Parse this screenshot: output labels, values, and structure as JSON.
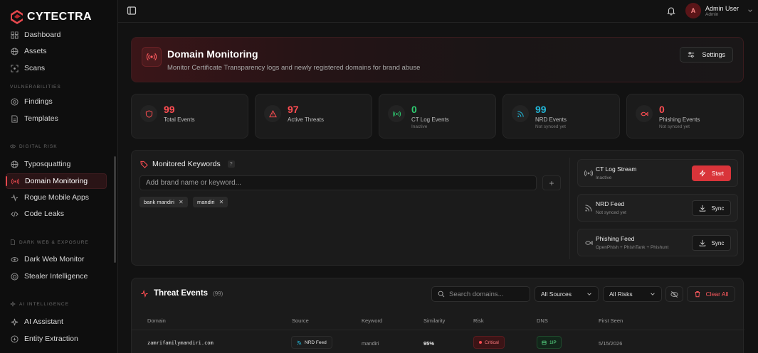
{
  "app": {
    "brand": "CYTECTRA"
  },
  "sidebar": {
    "items_top": [
      {
        "label": "Dashboard",
        "icon": "dashboard-icon"
      },
      {
        "label": "Assets",
        "icon": "globe-icon"
      },
      {
        "label": "Scans",
        "icon": "scan-icon"
      }
    ],
    "sections": {
      "vulnerabilities": "VULNERABILITIES",
      "digital_risk": "DIGITAL RISK",
      "dark_web": "DARK WEB & EXPOSURE",
      "ai": "AI INTELLIGENCE"
    },
    "vuln_items": [
      {
        "label": "Findings",
        "icon": "findings-icon"
      },
      {
        "label": "Templates",
        "icon": "templates-icon"
      }
    ],
    "risk_items": [
      {
        "label": "Typosquatting",
        "icon": "globe-icon"
      },
      {
        "label": "Domain Monitoring",
        "icon": "radio-icon",
        "active": true
      },
      {
        "label": "Rogue Mobile Apps",
        "icon": "activity-icon"
      },
      {
        "label": "Code Leaks",
        "icon": "code-icon"
      }
    ],
    "darkweb_items": [
      {
        "label": "Dark Web Monitor",
        "icon": "eye-icon"
      },
      {
        "label": "Stealer Intelligence",
        "icon": "target-icon"
      }
    ],
    "ai_items": [
      {
        "label": "AI Assistant",
        "icon": "sparkle-icon"
      },
      {
        "label": "Entity Extraction",
        "icon": "extract-icon"
      }
    ]
  },
  "topbar": {
    "user_initial": "A",
    "user_name": "Admin User",
    "user_role": "Admin"
  },
  "header": {
    "title": "Domain Monitoring",
    "subtitle": "Monitor Certificate Transparency logs and newly registered domains for brand abuse",
    "settings_label": "Settings"
  },
  "stats": [
    {
      "value": "99",
      "label": "Total Events",
      "sub": "",
      "color": "#ff4d52"
    },
    {
      "value": "97",
      "label": "Active Threats",
      "sub": "",
      "color": "#ff4d52"
    },
    {
      "value": "0",
      "label": "CT Log Events",
      "sub": "Inactive",
      "color": "#2ecc71"
    },
    {
      "value": "99",
      "label": "NRD Events",
      "sub": "Not synced yet",
      "color": "#22b5d6"
    },
    {
      "value": "0",
      "label": "Phishing Events",
      "sub": "Not synced yet",
      "color": "#ff4d52"
    }
  ],
  "keywords": {
    "title": "Monitored Keywords",
    "help": "?",
    "placeholder": "Add brand name or keyword...",
    "chips": [
      "bank mandiri",
      "mandiri"
    ]
  },
  "feeds": [
    {
      "title": "CT Log Stream",
      "sub": "Inactive",
      "button": "Start"
    },
    {
      "title": "NRD Feed",
      "sub": "Not synced yet",
      "button": "Sync"
    },
    {
      "title": "Phishing Feed",
      "sub": "OpenPhish + PhishTank + Phishunt",
      "button": "Sync"
    }
  ],
  "threats": {
    "title": "Threat Events",
    "count": "(99)",
    "search_placeholder": "Search domains...",
    "source_filter": "All Sources",
    "risk_filter": "All Risks",
    "clear_label": "Clear All",
    "columns": [
      "Domain",
      "Source",
      "Keyword",
      "Similarity",
      "Risk",
      "DNS",
      "First Seen"
    ],
    "rows": [
      {
        "domain": "zamrifamilymandiri.com",
        "source": "NRD Feed",
        "keyword": "mandiri",
        "similarity": "95%",
        "risk": "Critical",
        "dns": "1IP",
        "first_seen": "5/15/2026"
      }
    ]
  }
}
